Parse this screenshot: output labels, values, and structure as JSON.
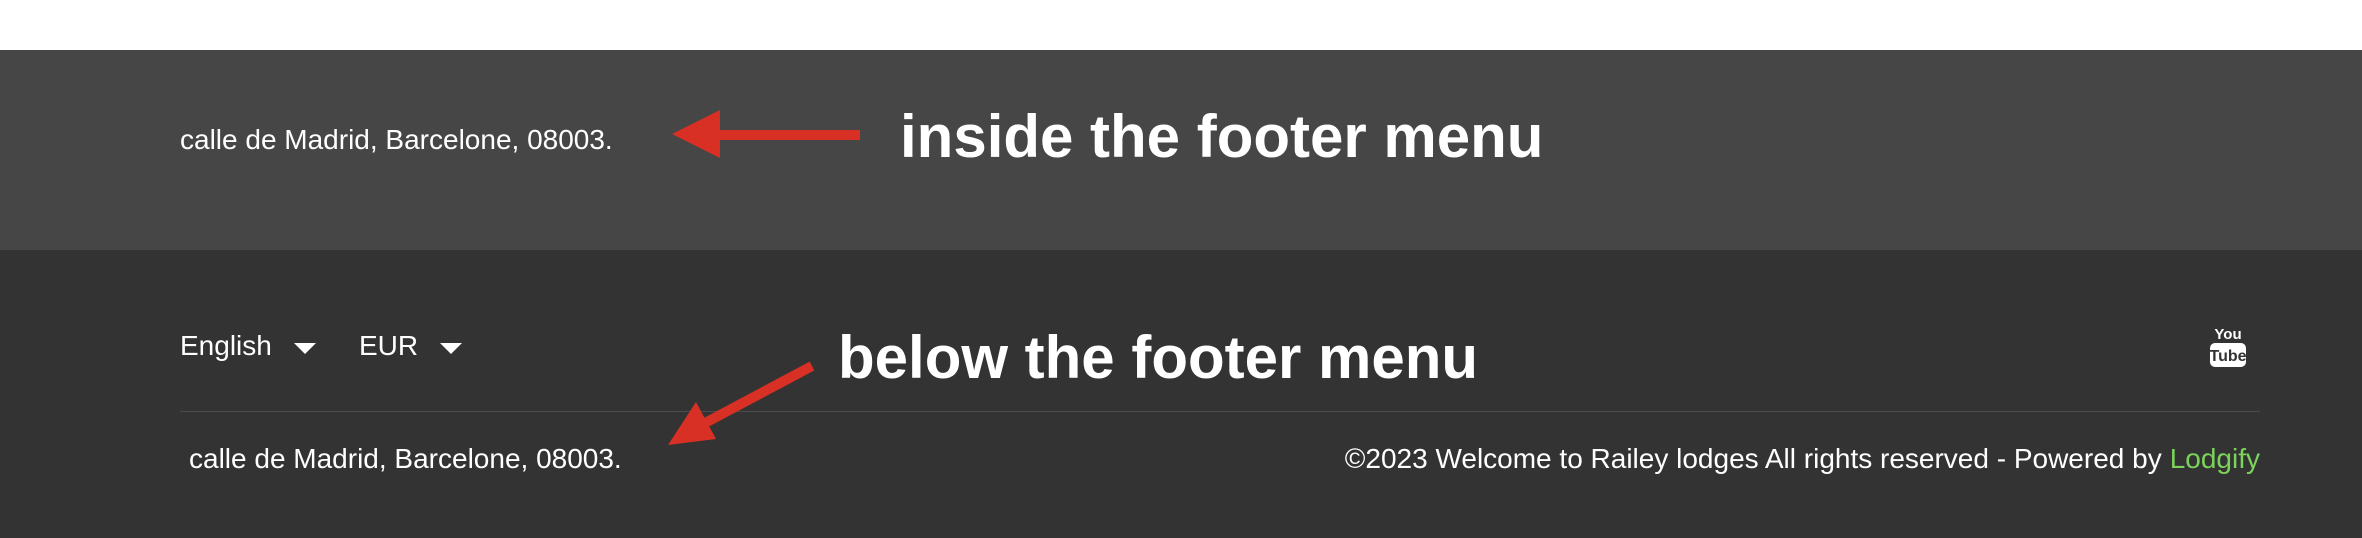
{
  "colors": {
    "footer_menu_bg": "#464646",
    "footer_bottom_bg": "#333333",
    "annotation_arrow": "#d93025",
    "link_accent": "#7bd35a"
  },
  "footer_menu": {
    "address": "calle de Madrid, Barcelone, 08003."
  },
  "annotations": {
    "inside": "inside the footer menu",
    "below": "below the footer menu"
  },
  "footer_bottom": {
    "language": {
      "selected": "English",
      "icon": "chevron-down-icon"
    },
    "currency": {
      "selected": "EUR",
      "icon": "chevron-down-icon"
    },
    "social": {
      "icon": "youtube-icon"
    },
    "address": "calle de Madrid, Barcelone, 08003.",
    "copyright_text": "©2023 Welcome to Railey lodges All rights reserved - Powered by",
    "powered_by_link": "Lodgify"
  }
}
